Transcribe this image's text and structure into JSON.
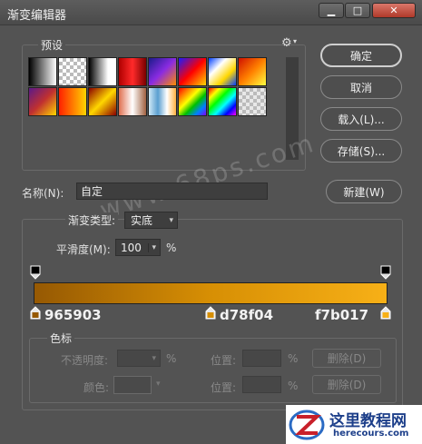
{
  "window": {
    "title": "渐变编辑器",
    "btn_min": "▁",
    "btn_max": "□",
    "btn_close": "✕"
  },
  "presets": {
    "label": "预设",
    "gear_icon": "⚙",
    "swatches": [
      "linear-gradient(90deg,#000,#fff)",
      "checker-white",
      "linear-gradient(90deg,#000,#fff 70%)",
      "linear-gradient(90deg,#b00000,#ff2a2a,#7a0000)",
      "linear-gradient(135deg,#1b1b8a,#8a2be2,#ff8c00)",
      "linear-gradient(135deg,#1a1aff,#ff0000,#ffd700)",
      "linear-gradient(135deg,#0040ff,#ffffff,#ffd700,#0040ff)",
      "linear-gradient(135deg,#d01000,#ff8000,#ffff40)",
      "linear-gradient(135deg,#5a1a8a,#c03030,#ffd700)",
      "linear-gradient(90deg,#ff2000,#ffd400)",
      "linear-gradient(135deg,#8a0000,#ffd700,#8a0000)",
      "linear-gradient(90deg,#e07050,#fff,#a06040)",
      "linear-gradient(90deg,#cfe8f6,#5a9fd0,#fff,#ffb040)",
      "linear-gradient(135deg,#ff0000,#ff8000,#ffff00,#00c000,#0080ff,#8000ff)",
      "linear-gradient(135deg,#ff0000 0%,#ffff00 20%,#00ff00 40%,#00ffff 60%,#0000ff 80%,#ff00ff 100%)",
      "checker-color"
    ]
  },
  "actions": {
    "ok": "确定",
    "cancel": "取消",
    "load": "载入(L)...",
    "save": "存储(S)...",
    "new": "新建(W)"
  },
  "name_field": {
    "label": "名称(N):",
    "value": "自定"
  },
  "gradient": {
    "type_label": "渐变类型:",
    "type_value": "实底",
    "smooth_label": "平滑度(M):",
    "smooth_value": "100",
    "smooth_unit": "%",
    "stops": [
      {
        "offset": 0.0,
        "color": "#965903",
        "label": "965903"
      },
      {
        "offset": 0.5,
        "color": "#d78f04",
        "label": "d78f04"
      },
      {
        "offset": 1.0,
        "color": "#f7b017",
        "label": "f7b017"
      }
    ]
  },
  "stops_panel": {
    "label": "色标",
    "opacity_label": "不透明度:",
    "opacity_unit": "%",
    "location_label": "位置:",
    "location_unit": "%",
    "delete_label": "删除(D)",
    "color_label": "颜色:"
  },
  "watermark": {
    "text": "www.68ps.com",
    "logo_text": "这里教程网",
    "logo_url": "herecours.com"
  }
}
